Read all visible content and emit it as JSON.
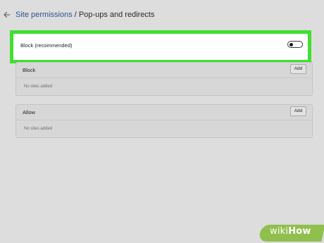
{
  "header": {
    "back_icon": "arrow-left-icon",
    "breadcrumb_link": "Site permissions",
    "separator": " / ",
    "page_title": "Pop-ups and redirects"
  },
  "block_setting": {
    "label": "Block (recommended)",
    "toggle_on": false
  },
  "block_list": {
    "title": "Block",
    "add_label": "Add",
    "empty_text": "No sites added"
  },
  "allow_list": {
    "title": "Allow",
    "add_label": "Add",
    "empty_text": "No sites added"
  },
  "watermark": {
    "wiki": "wiki",
    "how": "How"
  },
  "colors": {
    "highlight": "#3fe02f",
    "link": "#2b5593",
    "page_background": "#dddddd"
  }
}
